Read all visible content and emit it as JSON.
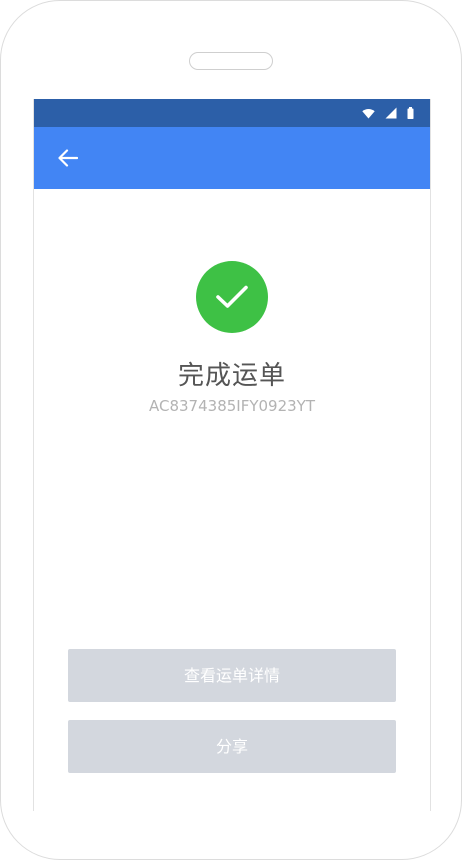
{
  "status_bar": {
    "icons": [
      "wifi-icon",
      "signal-icon",
      "battery-icon"
    ]
  },
  "app_bar": {
    "back_icon": "arrow-left-icon"
  },
  "result": {
    "icon": "check-icon",
    "title": "完成运单",
    "order_number": "AC8374385IFY0923YT"
  },
  "actions": {
    "view_details_label": "查看运单详情",
    "share_label": "分享"
  },
  "colors": {
    "status_bar": "#2c5fa8",
    "app_bar": "#4285f4",
    "success": "#3ec145",
    "button_bg": "#d3d7de"
  }
}
